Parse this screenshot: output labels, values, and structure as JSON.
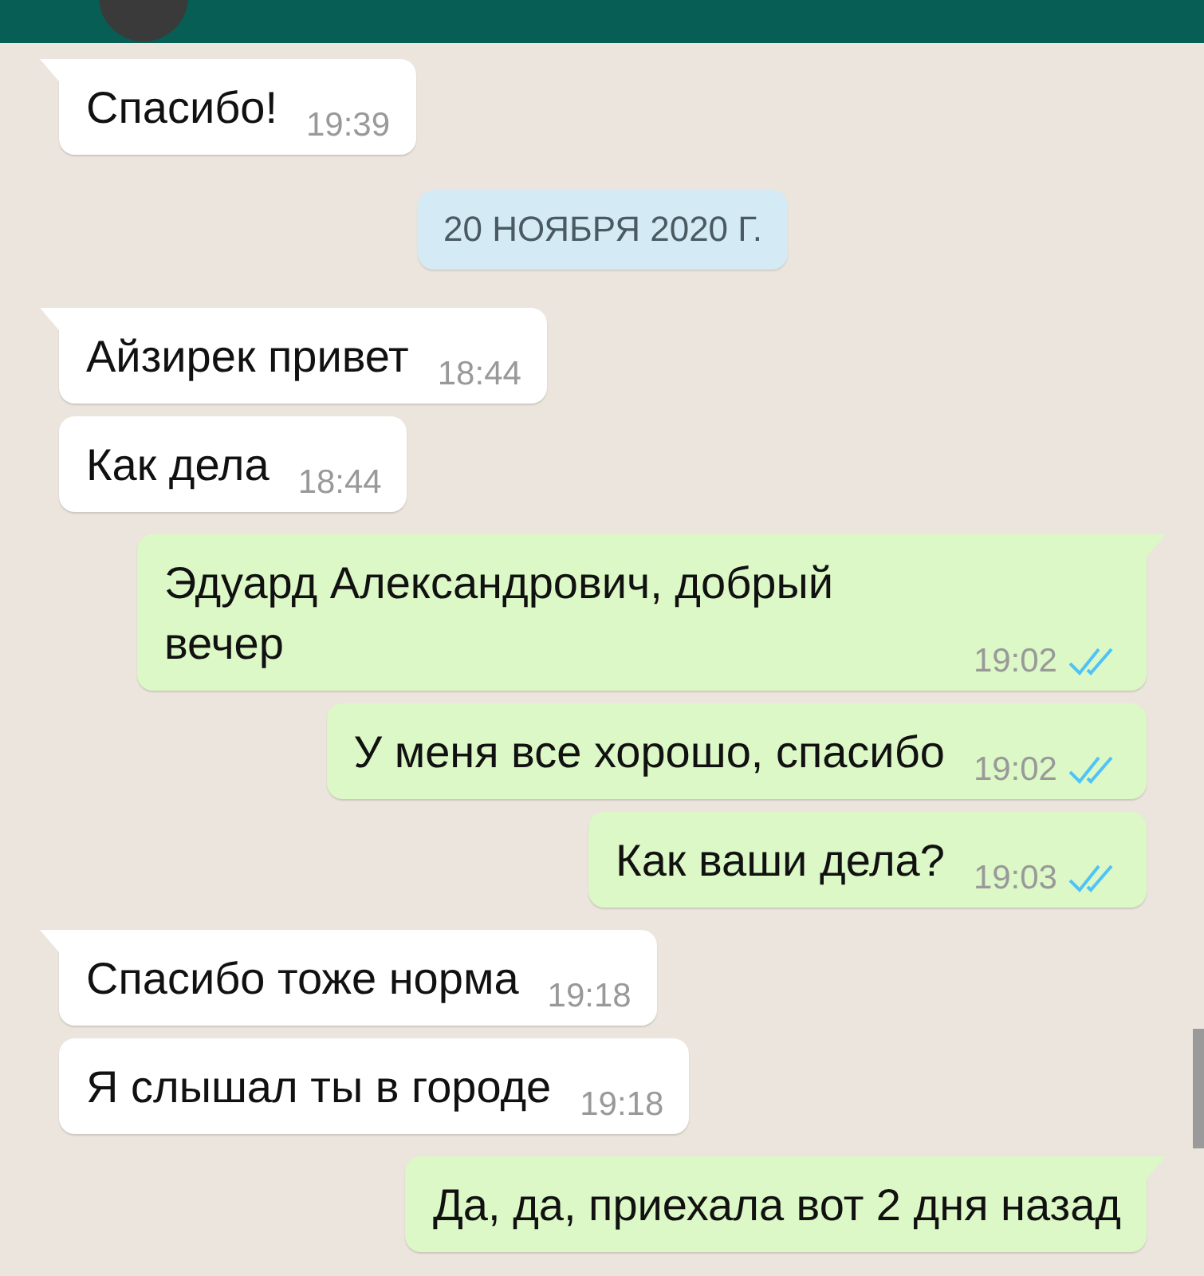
{
  "messages": [
    {
      "kind": "in",
      "tail": true,
      "text": "Спасибо!",
      "time": "19:39"
    },
    {
      "kind": "date",
      "text": "20 НОЯБРЯ 2020 Г."
    },
    {
      "kind": "in",
      "tail": true,
      "text": "Айзирек привет",
      "time": "18:44"
    },
    {
      "kind": "in",
      "tail": false,
      "text": "Как дела",
      "time": "18:44"
    },
    {
      "kind": "out",
      "tail": true,
      "text": "Эдуард Александрович, добрый вечер",
      "time": "19:02",
      "read": true
    },
    {
      "kind": "out",
      "tail": false,
      "text": "У меня все хорошо, спасибо",
      "time": "19:02",
      "read": true
    },
    {
      "kind": "out",
      "tail": false,
      "text": "Как ваши дела?",
      "time": "19:03",
      "read": true
    },
    {
      "kind": "in",
      "tail": true,
      "text": "Спасибо тоже норма",
      "time": "19:18"
    },
    {
      "kind": "in",
      "tail": false,
      "text": "Я слышал ты в городе",
      "time": "19:18"
    },
    {
      "kind": "out",
      "tail": true,
      "text": "Да, да, приехала вот 2 дня назад"
    }
  ]
}
